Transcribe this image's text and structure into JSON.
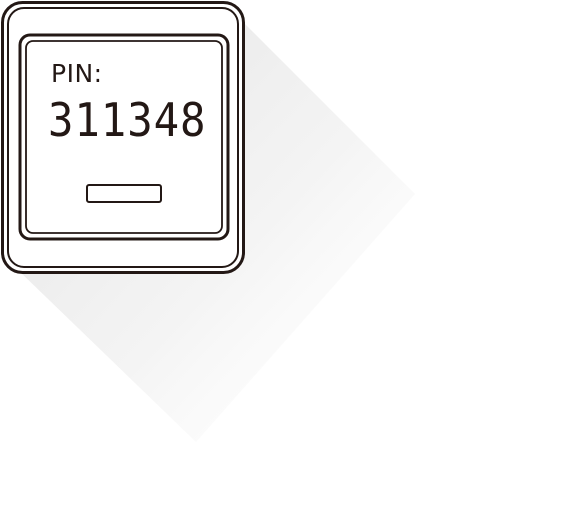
{
  "device": {
    "label": "PIN:",
    "code": "311348"
  },
  "colors": {
    "stroke": "#231815",
    "shadow": "#e6e6e6",
    "background": "#ffffff"
  }
}
